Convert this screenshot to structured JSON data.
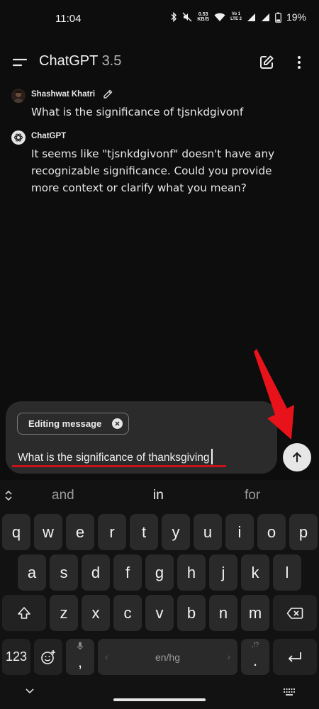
{
  "status_bar": {
    "time": "11:04",
    "net_speed_value": "0.53",
    "net_speed_unit": "KB/S",
    "network_top": "Vo 1",
    "network_bottom": "LTE 2",
    "battery": "19%"
  },
  "header": {
    "title": "ChatGPT",
    "version": "3.5"
  },
  "conversation": {
    "user": {
      "name": "Shashwat Khatri",
      "message": "What is the significance of tjsnkdgivonf"
    },
    "assistant": {
      "name": "ChatGPT",
      "message": "It seems like \"tjsnkdgivonf\" doesn't have any recognizable significance. Could you provide more context or clarify what you mean?"
    }
  },
  "composer": {
    "chip_label": "Editing message",
    "input_value": "What is the significance of thanksgiving"
  },
  "keyboard": {
    "suggestions": [
      "and",
      "in",
      "for"
    ],
    "row1": [
      "q",
      "w",
      "e",
      "r",
      "t",
      "y",
      "u",
      "i",
      "o",
      "p"
    ],
    "row2": [
      "a",
      "s",
      "d",
      "f",
      "g",
      "h",
      "j",
      "k",
      "l"
    ],
    "row3": [
      "z",
      "x",
      "c",
      "v",
      "b",
      "n",
      "m"
    ],
    "numbers_label": "123",
    "comma_label": ",",
    "space_label": "en/hg",
    "period_label": ".",
    "period_sub": ",!?"
  },
  "colors": {
    "background": "#0d0d0d",
    "composer": "#2b2b2b",
    "key": "#2a2a2a",
    "annotation_red": "#e8121a"
  }
}
